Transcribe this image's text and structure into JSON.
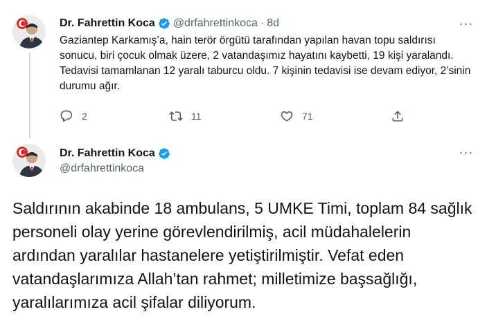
{
  "tweet1": {
    "display_name": "Dr. Fahrettin Koca",
    "handle": "@drfahrettinkoca",
    "separator": "·",
    "time": "8d",
    "text": "Gaziantep Karkamış’a, hain terör örgütü tarafından yapılan havan topu saldırısı sonucu, biri çocuk olmak üzere, 2 vatandaşımız hayatını kaybetti, 19 kişi yaralandı. Tedavisi tamamlanan 12 yaralı taburcu oldu. 7 kişinin tedavisi ise devam ediyor, 2’sinin durumu ağır.",
    "reply_count": "2",
    "retweet_count": "11",
    "like_count": "71",
    "more_label": "···"
  },
  "tweet2": {
    "display_name": "Dr. Fahrettin Koca",
    "handle": "@drfahrettinkoca",
    "text": "Saldırının akabinde 18 ambulans, 5 UMKE Timi, toplam 84 sağlık personeli olay yerine görevlendirilmiş, acil müdahalelerin ardından yaralılar hastanelere yetiştirilmiştir. Vefat eden vatandaşlarımıza Allah’tan rahmet; milletimize başsağlığı, yaralılarımıza acil şifalar diliyorum.",
    "more_label": "···"
  },
  "icons": {
    "verified": "verified-badge-icon",
    "reply": "reply-icon",
    "retweet": "retweet-icon",
    "like": "heart-icon",
    "share": "share-icon",
    "more": "more-icon"
  },
  "colors": {
    "text_primary": "#0f1419",
    "text_secondary": "#536471",
    "verified": "#1d9bf0",
    "thread_line": "#cfd9de"
  }
}
